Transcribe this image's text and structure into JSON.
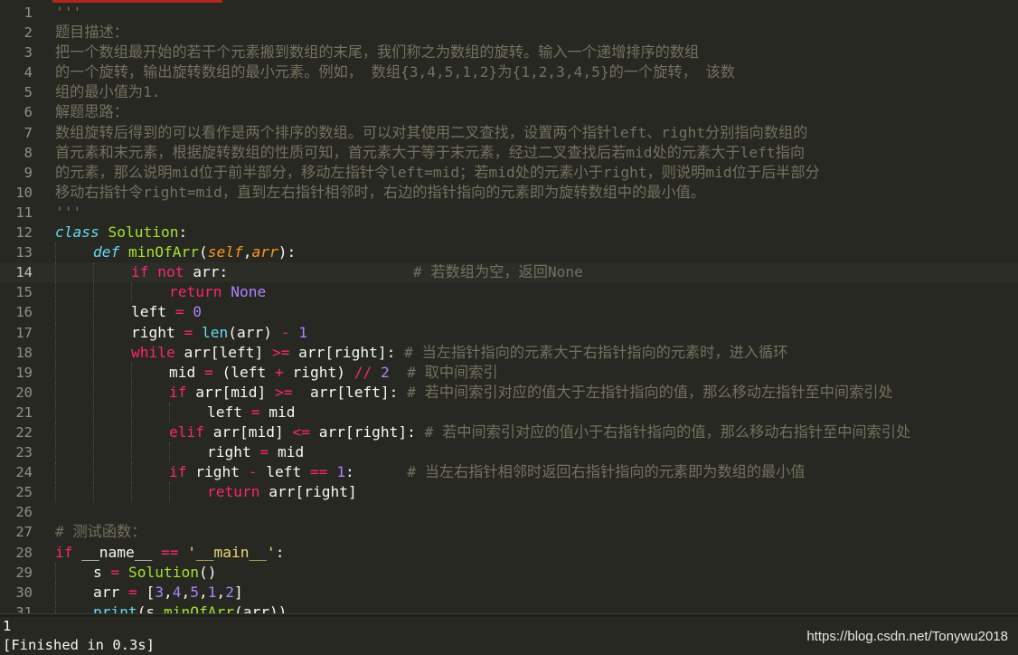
{
  "editor": {
    "lines": [
      {
        "n": "1",
        "indent": 0,
        "tokens": [
          {
            "t": "'''",
            "c": "cm"
          }
        ]
      },
      {
        "n": "2",
        "indent": 0,
        "tokens": [
          {
            "t": "题目描述：",
            "c": "cm"
          }
        ]
      },
      {
        "n": "3",
        "indent": 0,
        "tokens": [
          {
            "t": "把一个数组最开始的若干个元素搬到数组的末尾，我们称之为数组的旋转。输入一个递增排序的数组",
            "c": "cm"
          }
        ]
      },
      {
        "n": "4",
        "indent": 0,
        "tokens": [
          {
            "t": "的一个旋转，输出旋转数组的最小元素。例如， 数组{3,4,5,1,2}为{1,2,3,4,5}的一个旋转， 该数",
            "c": "cm"
          }
        ]
      },
      {
        "n": "5",
        "indent": 0,
        "tokens": [
          {
            "t": "组的最小值为1.",
            "c": "cm"
          }
        ]
      },
      {
        "n": "6",
        "indent": 0,
        "tokens": [
          {
            "t": "解题思路：",
            "c": "cm"
          }
        ]
      },
      {
        "n": "7",
        "indent": 0,
        "tokens": [
          {
            "t": "数组旋转后得到的可以看作是两个排序的数组。可以对其使用二叉查找，设置两个指针left、right分别指向数组的",
            "c": "cm"
          }
        ]
      },
      {
        "n": "8",
        "indent": 0,
        "tokens": [
          {
            "t": "首元素和末元素，根据旋转数组的性质可知，首元素大于等于末元素，经过二叉查找后若mid处的元素大于left指向",
            "c": "cm"
          }
        ]
      },
      {
        "n": "9",
        "indent": 0,
        "tokens": [
          {
            "t": "的元素，那么说明mid位于前半部分，移动左指针令left=mid；若mid处的元素小于right，则说明mid位于后半部分",
            "c": "cm"
          }
        ]
      },
      {
        "n": "10",
        "indent": 0,
        "tokens": [
          {
            "t": "移动右指针令right=mid，直到左右指针相邻时，右边的指针指向的元素即为旋转数组中的最小值。",
            "c": "cm"
          }
        ]
      },
      {
        "n": "11",
        "indent": 0,
        "tokens": [
          {
            "t": "'''",
            "c": "cm"
          }
        ]
      },
      {
        "n": "12",
        "indent": 0,
        "tokens": [
          {
            "t": "class",
            "c": "cls"
          },
          {
            "t": " "
          },
          {
            "t": "Solution",
            "c": "fn"
          },
          {
            "t": ":"
          }
        ]
      },
      {
        "n": "13",
        "indent": 1,
        "tokens": [
          {
            "t": "def",
            "c": "def"
          },
          {
            "t": " "
          },
          {
            "t": "minOfArr",
            "c": "fn"
          },
          {
            "t": "("
          },
          {
            "t": "self",
            "c": "prm"
          },
          {
            "t": ","
          },
          {
            "t": "arr",
            "c": "prm"
          },
          {
            "t": "):"
          }
        ]
      },
      {
        "n": "14",
        "indent": 2,
        "current": true,
        "tokens": [
          {
            "t": "if",
            "c": "kw"
          },
          {
            "t": " "
          },
          {
            "t": "not",
            "c": "kw"
          },
          {
            "t": " arr:                     "
          },
          {
            "t": "# 若数组为空，返回None",
            "c": "cm"
          }
        ]
      },
      {
        "n": "15",
        "indent": 3,
        "tokens": [
          {
            "t": "return",
            "c": "kw"
          },
          {
            "t": " "
          },
          {
            "t": "None",
            "c": "num"
          }
        ]
      },
      {
        "n": "16",
        "indent": 2,
        "tokens": [
          {
            "t": "left "
          },
          {
            "t": "=",
            "c": "op"
          },
          {
            "t": " "
          },
          {
            "t": "0",
            "c": "num"
          }
        ]
      },
      {
        "n": "17",
        "indent": 2,
        "tokens": [
          {
            "t": "right "
          },
          {
            "t": "=",
            "c": "op"
          },
          {
            "t": " "
          },
          {
            "t": "len",
            "c": "bi"
          },
          {
            "t": "(arr) "
          },
          {
            "t": "-",
            "c": "op"
          },
          {
            "t": " "
          },
          {
            "t": "1",
            "c": "num"
          }
        ]
      },
      {
        "n": "18",
        "indent": 2,
        "tokens": [
          {
            "t": "while",
            "c": "kw"
          },
          {
            "t": " arr[left] "
          },
          {
            "t": ">=",
            "c": "op"
          },
          {
            "t": " arr[right]: "
          },
          {
            "t": "# 当左指针指向的元素大于右指针指向的元素时，进入循环",
            "c": "cm"
          }
        ]
      },
      {
        "n": "19",
        "indent": 3,
        "tokens": [
          {
            "t": "mid "
          },
          {
            "t": "=",
            "c": "op"
          },
          {
            "t": " (left "
          },
          {
            "t": "+",
            "c": "op"
          },
          {
            "t": " right) "
          },
          {
            "t": "//",
            "c": "op"
          },
          {
            "t": " "
          },
          {
            "t": "2",
            "c": "num"
          },
          {
            "t": "  "
          },
          {
            "t": "# 取中间索引",
            "c": "cm"
          }
        ]
      },
      {
        "n": "20",
        "indent": 3,
        "tokens": [
          {
            "t": "if",
            "c": "kw"
          },
          {
            "t": " arr[mid] "
          },
          {
            "t": ">=",
            "c": "op"
          },
          {
            "t": "  arr[left]: "
          },
          {
            "t": "# 若中间索引对应的值大于左指针指向的值，那么移动左指针至中间索引处",
            "c": "cm"
          }
        ]
      },
      {
        "n": "21",
        "indent": 4,
        "tokens": [
          {
            "t": "left "
          },
          {
            "t": "=",
            "c": "op"
          },
          {
            "t": " mid"
          }
        ]
      },
      {
        "n": "22",
        "indent": 3,
        "tokens": [
          {
            "t": "elif",
            "c": "kw"
          },
          {
            "t": " arr[mid] "
          },
          {
            "t": "<=",
            "c": "op"
          },
          {
            "t": " arr[right]: "
          },
          {
            "t": "# 若中间索引对应的值小于右指针指向的值，那么移动右指针至中间索引处",
            "c": "cm"
          }
        ]
      },
      {
        "n": "23",
        "indent": 4,
        "tokens": [
          {
            "t": "right "
          },
          {
            "t": "=",
            "c": "op"
          },
          {
            "t": " mid"
          }
        ]
      },
      {
        "n": "24",
        "indent": 3,
        "tokens": [
          {
            "t": "if",
            "c": "kw"
          },
          {
            "t": " right "
          },
          {
            "t": "-",
            "c": "op"
          },
          {
            "t": " left "
          },
          {
            "t": "==",
            "c": "op"
          },
          {
            "t": " "
          },
          {
            "t": "1",
            "c": "num"
          },
          {
            "t": ":      "
          },
          {
            "t": "# 当左右指针相邻时返回右指针指向的元素即为数组的最小值",
            "c": "cm"
          }
        ]
      },
      {
        "n": "25",
        "indent": 4,
        "tokens": [
          {
            "t": "return",
            "c": "kw"
          },
          {
            "t": " arr[right]"
          }
        ]
      },
      {
        "n": "26",
        "indent": 0,
        "tokens": []
      },
      {
        "n": "27",
        "indent": 0,
        "tokens": [
          {
            "t": "# 测试函数：",
            "c": "cm"
          }
        ]
      },
      {
        "n": "28",
        "indent": 0,
        "tokens": [
          {
            "t": "if",
            "c": "kw"
          },
          {
            "t": " __name__ "
          },
          {
            "t": "==",
            "c": "op"
          },
          {
            "t": " "
          },
          {
            "t": "'__main__'",
            "c": "str"
          },
          {
            "t": ":"
          }
        ]
      },
      {
        "n": "29",
        "indent": 1,
        "tokens": [
          {
            "t": "s "
          },
          {
            "t": "=",
            "c": "op"
          },
          {
            "t": " "
          },
          {
            "t": "Solution",
            "c": "fn"
          },
          {
            "t": "()"
          }
        ]
      },
      {
        "n": "30",
        "indent": 1,
        "tokens": [
          {
            "t": "arr "
          },
          {
            "t": "=",
            "c": "op"
          },
          {
            "t": " ["
          },
          {
            "t": "3",
            "c": "num"
          },
          {
            "t": ","
          },
          {
            "t": "4",
            "c": "num"
          },
          {
            "t": ","
          },
          {
            "t": "5",
            "c": "num"
          },
          {
            "t": ","
          },
          {
            "t": "1",
            "c": "num"
          },
          {
            "t": ","
          },
          {
            "t": "2",
            "c": "num"
          },
          {
            "t": "]"
          }
        ]
      },
      {
        "n": "31",
        "indent": 1,
        "tokens": [
          {
            "t": "print",
            "c": "bi"
          },
          {
            "t": "(s."
          },
          {
            "t": "minOfArr",
            "c": "fn"
          },
          {
            "t": "(arr))"
          }
        ]
      }
    ]
  },
  "output": {
    "lines": [
      "1",
      "[Finished in 0.3s]"
    ]
  },
  "watermark": "https://blog.csdn.net/Tonywu2018",
  "colors": {
    "background": "#272822",
    "keyword": "#f92672",
    "function": "#a6e22e",
    "comment": "#75715e",
    "number": "#ae81ff",
    "builtin": "#66d9ef",
    "string": "#e6db74",
    "parameter": "#fd971f",
    "tab_accent": "#b3261e"
  }
}
